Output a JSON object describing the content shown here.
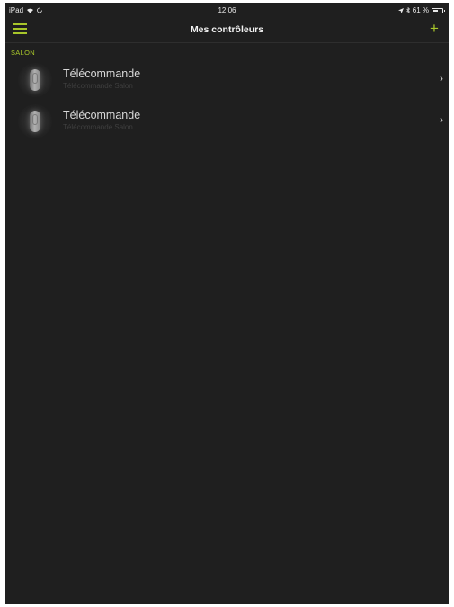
{
  "colors": {
    "accent": "#a8c62a",
    "background": "#1f1f1f"
  },
  "status_bar": {
    "device": "iPad",
    "time": "12:06",
    "battery_percent": "61 %",
    "battery_level": 0.61,
    "icons": [
      "wifi-icon",
      "sync-icon",
      "location-icon",
      "bluetooth-icon",
      "battery-icon"
    ]
  },
  "nav": {
    "title": "Mes contrôleurs",
    "menu_icon": "hamburger-menu-icon",
    "add_icon": "plus-icon",
    "add_label": "+"
  },
  "section": {
    "title": "SALON"
  },
  "devices": [
    {
      "name": "Télécommande",
      "subtitle": "Télécommande Salon",
      "icon": "remote-control-icon",
      "chevron": "›"
    },
    {
      "name": "Télécommande",
      "subtitle": "Télécommande Salon",
      "icon": "remote-control-icon",
      "chevron": "›"
    }
  ]
}
